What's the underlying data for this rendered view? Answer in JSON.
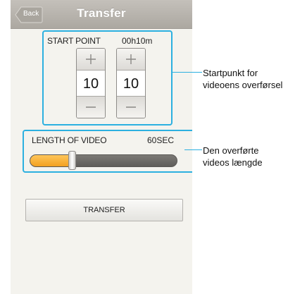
{
  "header": {
    "back_label": "Back",
    "title": "Transfer"
  },
  "start_point": {
    "label": "START POINT",
    "value": "00h10m",
    "steppers": [
      {
        "value": "10"
      },
      {
        "value": "10"
      }
    ]
  },
  "length": {
    "label": "LENGTH OF VIDEO",
    "value": "60SEC",
    "slider_fraction": 0.29
  },
  "transfer_button": {
    "label": "TRANSFER"
  },
  "callouts": {
    "start_point": {
      "line1": "Startpunkt for",
      "line2": "videoens overførsel"
    },
    "length": {
      "line1": "Den overførte",
      "line2": "videos længde"
    }
  },
  "colors": {
    "highlight": "#2cb0e0",
    "slider_fill": "#f2a020",
    "titlebar": "#b8b4ad"
  },
  "icons": {
    "increment": "plus-icon",
    "decrement": "minus-icon"
  }
}
